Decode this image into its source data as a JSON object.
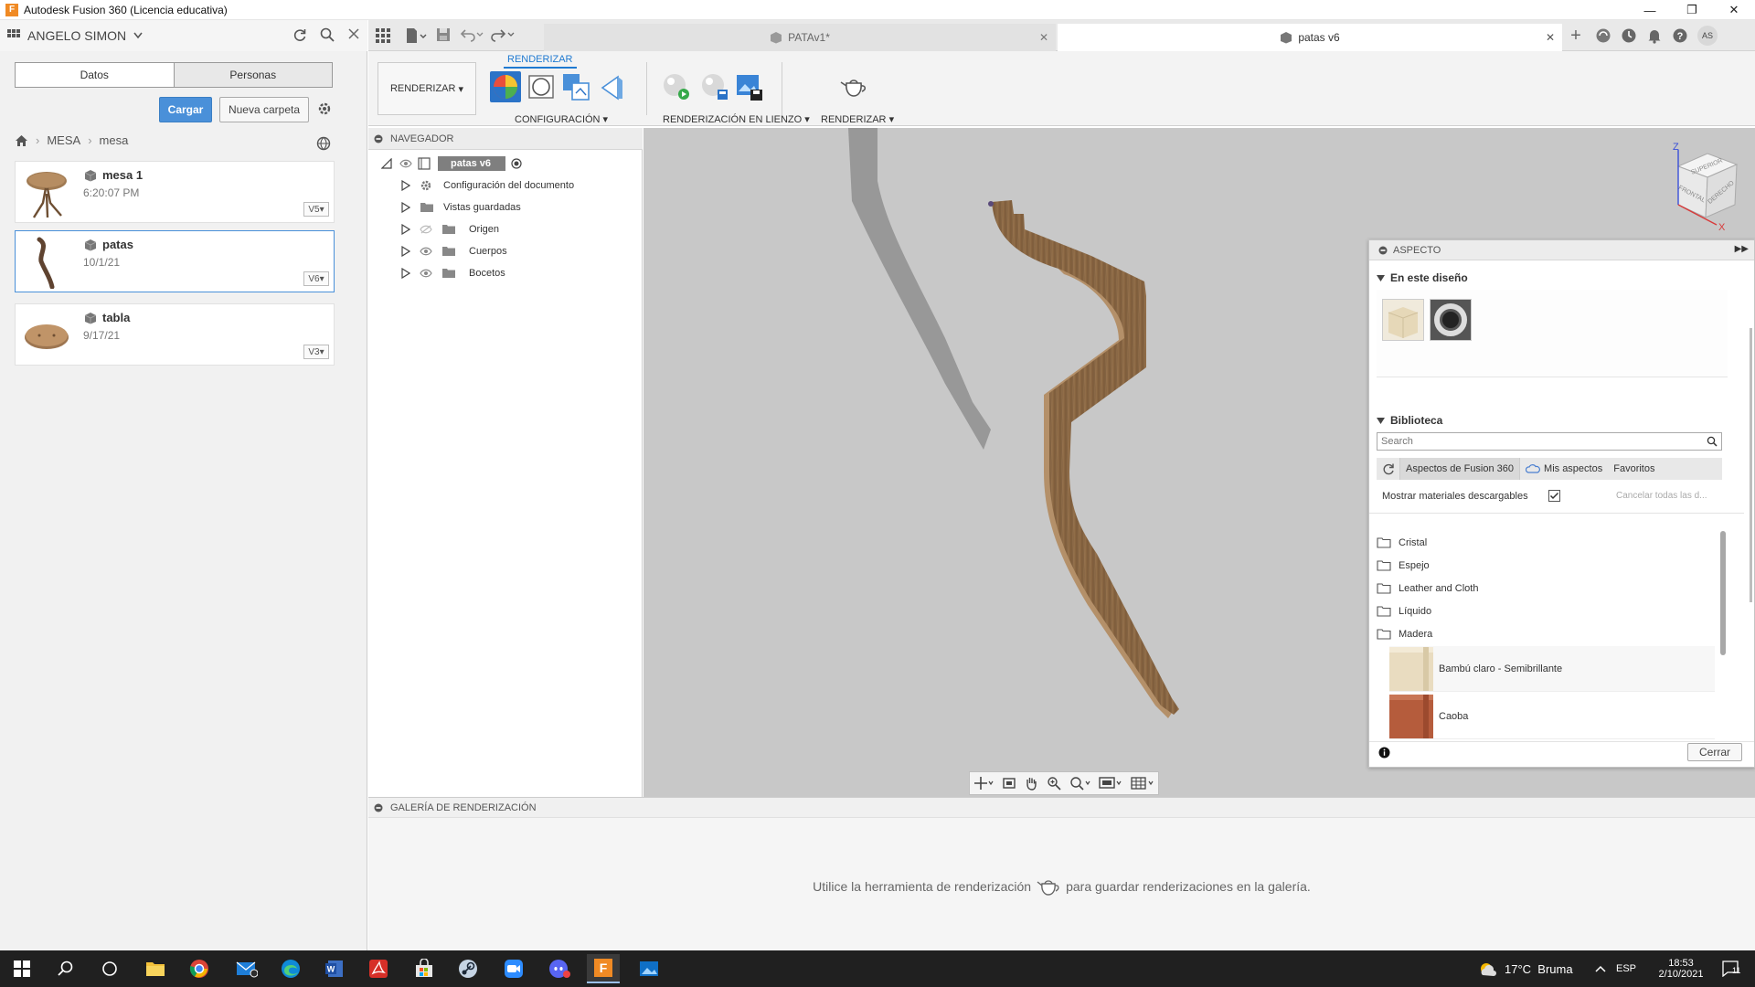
{
  "window": {
    "title": "Autodesk Fusion 360 (Licencia educativa)",
    "app_icon_letter": "F"
  },
  "data_panel": {
    "user": "ANGELO SIMON",
    "tabs": [
      "Datos",
      "Personas"
    ],
    "upload_button": "Cargar",
    "new_folder_button": "Nueva carpeta",
    "breadcrumb": [
      "MESA",
      "mesa"
    ],
    "items": [
      {
        "name": "mesa 1",
        "date": "6:20:07 PM",
        "version": "V5"
      },
      {
        "name": "patas",
        "date": "10/1/21",
        "version": "V6"
      },
      {
        "name": "tabla",
        "date": "9/17/21",
        "version": "V3"
      }
    ]
  },
  "doc_tabs": [
    {
      "label": "PATAv1*",
      "active": false
    },
    {
      "label": "patas v6",
      "active": true
    }
  ],
  "user_initials": "AS",
  "toolbar": {
    "workspace": "RENDERIZAR",
    "active_tab": "RENDERIZAR",
    "groups": [
      "CONFIGURACIÓN",
      "RENDERIZACIÓN EN LIENZO",
      "RENDERIZAR"
    ]
  },
  "navigator": {
    "title": "NAVEGADOR",
    "root": "patas v6",
    "nodes": [
      "Configuración del documento",
      "Vistas guardadas",
      "Origen",
      "Cuerpos",
      "Bocetos"
    ]
  },
  "viewcube": {
    "z": "Z",
    "x": "X",
    "faces": [
      "SUPERIOR",
      "FRONTAL",
      "DERECHO"
    ]
  },
  "aspect": {
    "title": "ASPECTO",
    "in_design": "En este diseño",
    "library": "Biblioteca",
    "search_placeholder": "Search",
    "source_tabs": [
      "Aspectos de Fusion 360",
      "Mis aspectos",
      "Favoritos"
    ],
    "show_downloadable": "Mostrar materiales descargables",
    "cancel_all": "Cancelar todas las d...",
    "categories": [
      "Cristal",
      "Espejo",
      "Leather and Cloth",
      "Líquido",
      "Madera"
    ],
    "materials": [
      "Bambú claro - Semibrillante",
      "Caoba"
    ],
    "close_button": "Cerrar",
    "colors": {
      "bamboo": "#e9dcc0",
      "mahogany": "#b55c3c"
    }
  },
  "gallery": {
    "title": "GALERÍA DE RENDERIZACIÓN",
    "hint_before": "Utilice la herramienta de renderización",
    "hint_after": "para guardar renderizaciones en la galería."
  },
  "taskbar": {
    "weather": "17°C  Bruma",
    "language": "ESP",
    "time": "18:53",
    "date": "2/10/2021",
    "notifications": "11"
  },
  "colors": {
    "accent": "#4a90d9",
    "brand": "#f08a24",
    "viewport": "#c8c8c8",
    "wood": "#8d6a45"
  }
}
